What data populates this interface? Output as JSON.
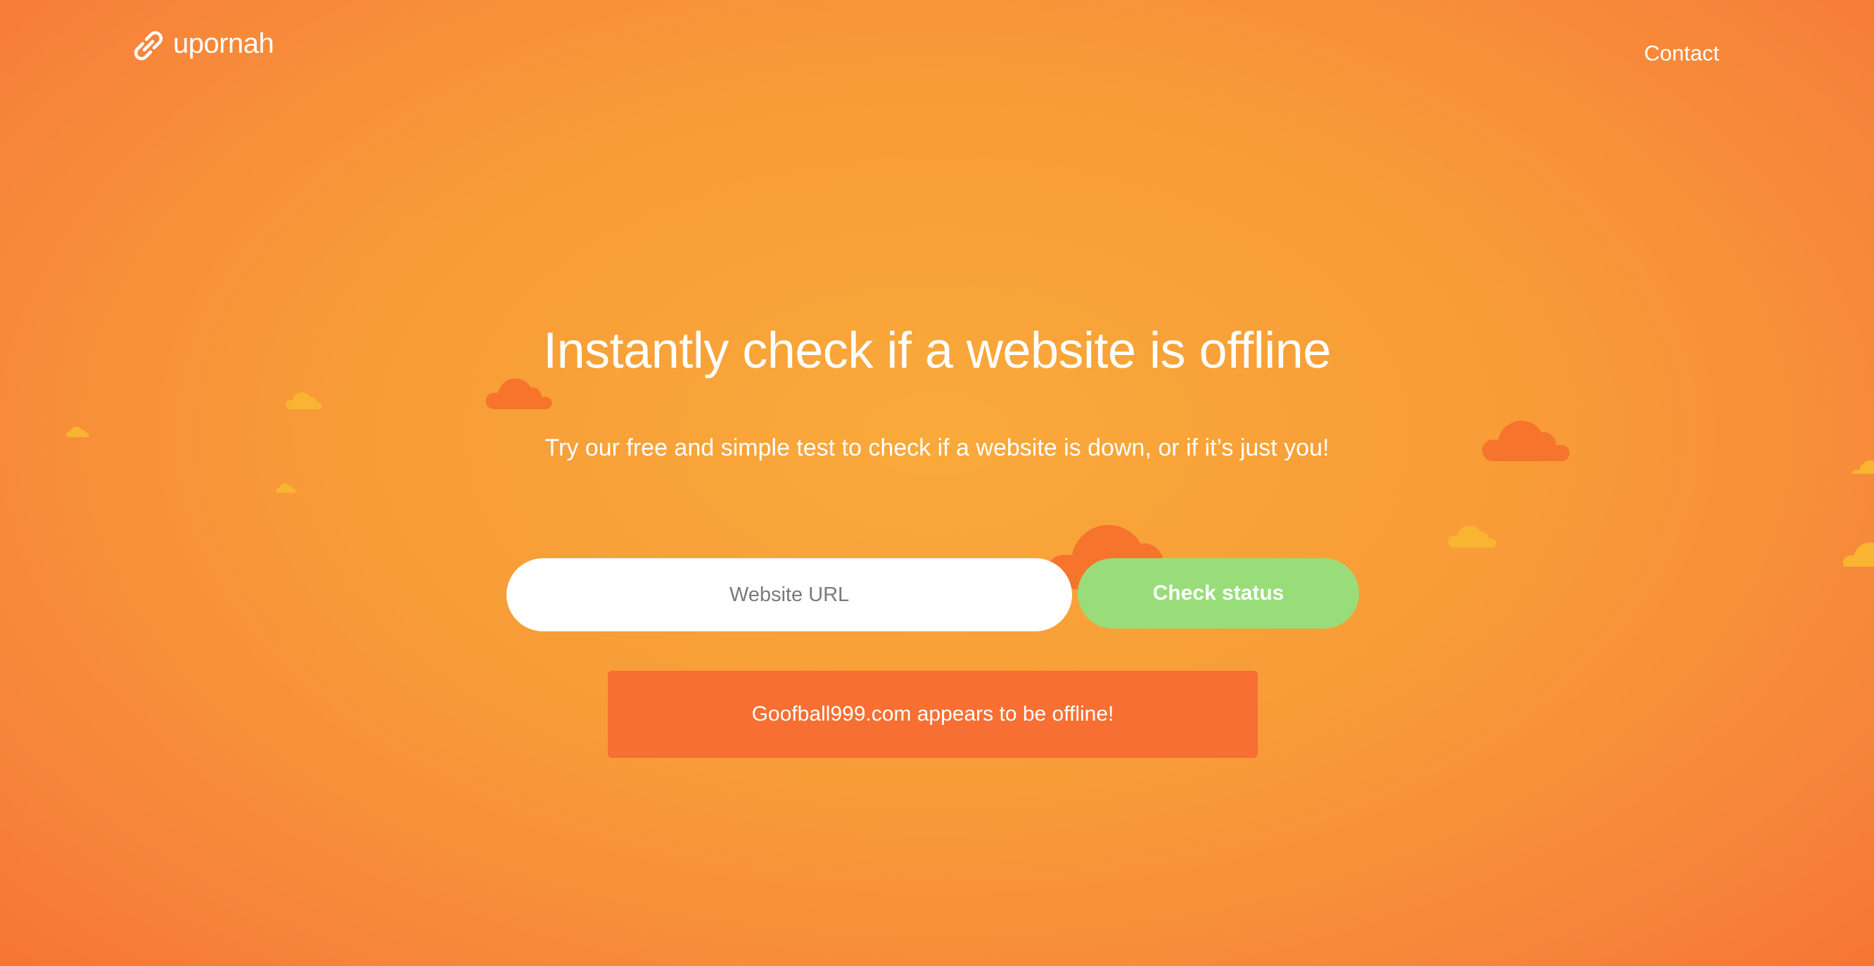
{
  "header": {
    "logo_text": "upornah",
    "logo_icon": "link-icon",
    "nav_contact": "Contact"
  },
  "hero": {
    "title": "Instantly check if a website is offline",
    "subtitle": "Try our free and simple test to check if a website is down, or if it’s just you!"
  },
  "form": {
    "url_placeholder": "Website URL",
    "url_value": "",
    "check_button_label": "Check status"
  },
  "result": {
    "message": "Goofball999.com appears to be offline!"
  },
  "colors": {
    "background_center": "#f9a93a",
    "background_edge": "#f77434",
    "cloud_dark": "#f7742c",
    "cloud_light": "#f9b431",
    "button_green": "#99dd7a",
    "banner_orange": "#f76f33",
    "text": "#ffffff"
  }
}
